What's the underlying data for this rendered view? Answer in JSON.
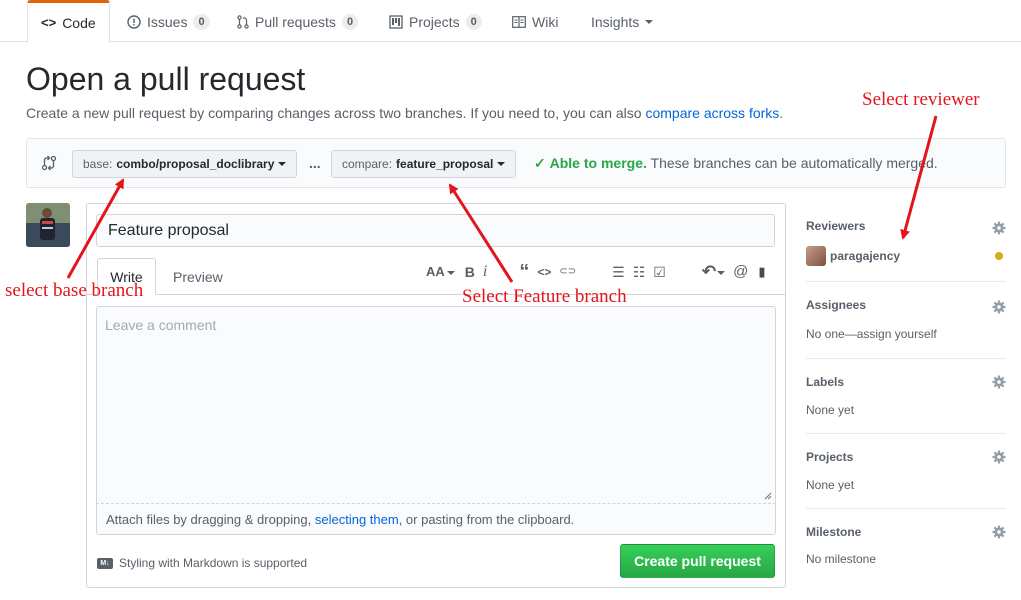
{
  "repo_nav": {
    "code": "Code",
    "issues": "Issues",
    "issues_count": "0",
    "pull_requests": "Pull requests",
    "pull_requests_count": "0",
    "projects": "Projects",
    "projects_count": "0",
    "wiki": "Wiki",
    "insights": "Insights"
  },
  "page": {
    "title": "Open a pull request",
    "subtitle": "Create a new pull request by comparing changes across two branches. If you need to, you can also",
    "subtitle_link": "compare across forks",
    "subtitle_end": "."
  },
  "range": {
    "base_label": "base:",
    "base_branch": "combo/proposal_doclibrary",
    "ellipsis": "...",
    "compare_label": "compare:",
    "compare_branch": "feature_proposal",
    "merge_status": "Able to merge.",
    "merge_text": "These branches can be automatically merged."
  },
  "form": {
    "title_value": "Feature proposal",
    "tab_write": "Write",
    "tab_preview": "Preview",
    "comment_placeholder": "Leave a comment",
    "attach_text_1": "Attach files by dragging & dropping,",
    "attach_link": "selecting them",
    "attach_text_2": ", or pasting from the clipboard.",
    "markdown_note": "Styling with Markdown is supported",
    "markdown_icon_text": "M↓",
    "submit": "Create pull request"
  },
  "toolbar": {
    "heading": "AA",
    "bold": "B",
    "italic": "i",
    "quote": "“",
    "code": "<>",
    "link": "⊂⊃",
    "bullets": "☰",
    "numbers": "☷",
    "tasks": "☑",
    "reply": "↶",
    "mention": "@",
    "bookmark": "▮"
  },
  "sidebar": {
    "reviewers": "Reviewers",
    "reviewer_name": "paragajency",
    "assignees": "Assignees",
    "assignees_value": "No one—assign yourself",
    "labels": "Labels",
    "labels_value": "None yet",
    "projects": "Projects",
    "projects_value": "None yet",
    "milestone": "Milestone",
    "milestone_value": "No milestone"
  },
  "annotations": {
    "reviewer": "Select reviewer",
    "base": "select base branch",
    "feature": "Select Feature branch"
  },
  "colors": {
    "accent_tab": "#e36209",
    "merge_green": "#28a745",
    "link_blue": "#0366d6",
    "annotation_red": "#e3151a",
    "pending_yellow": "#dbab09"
  }
}
